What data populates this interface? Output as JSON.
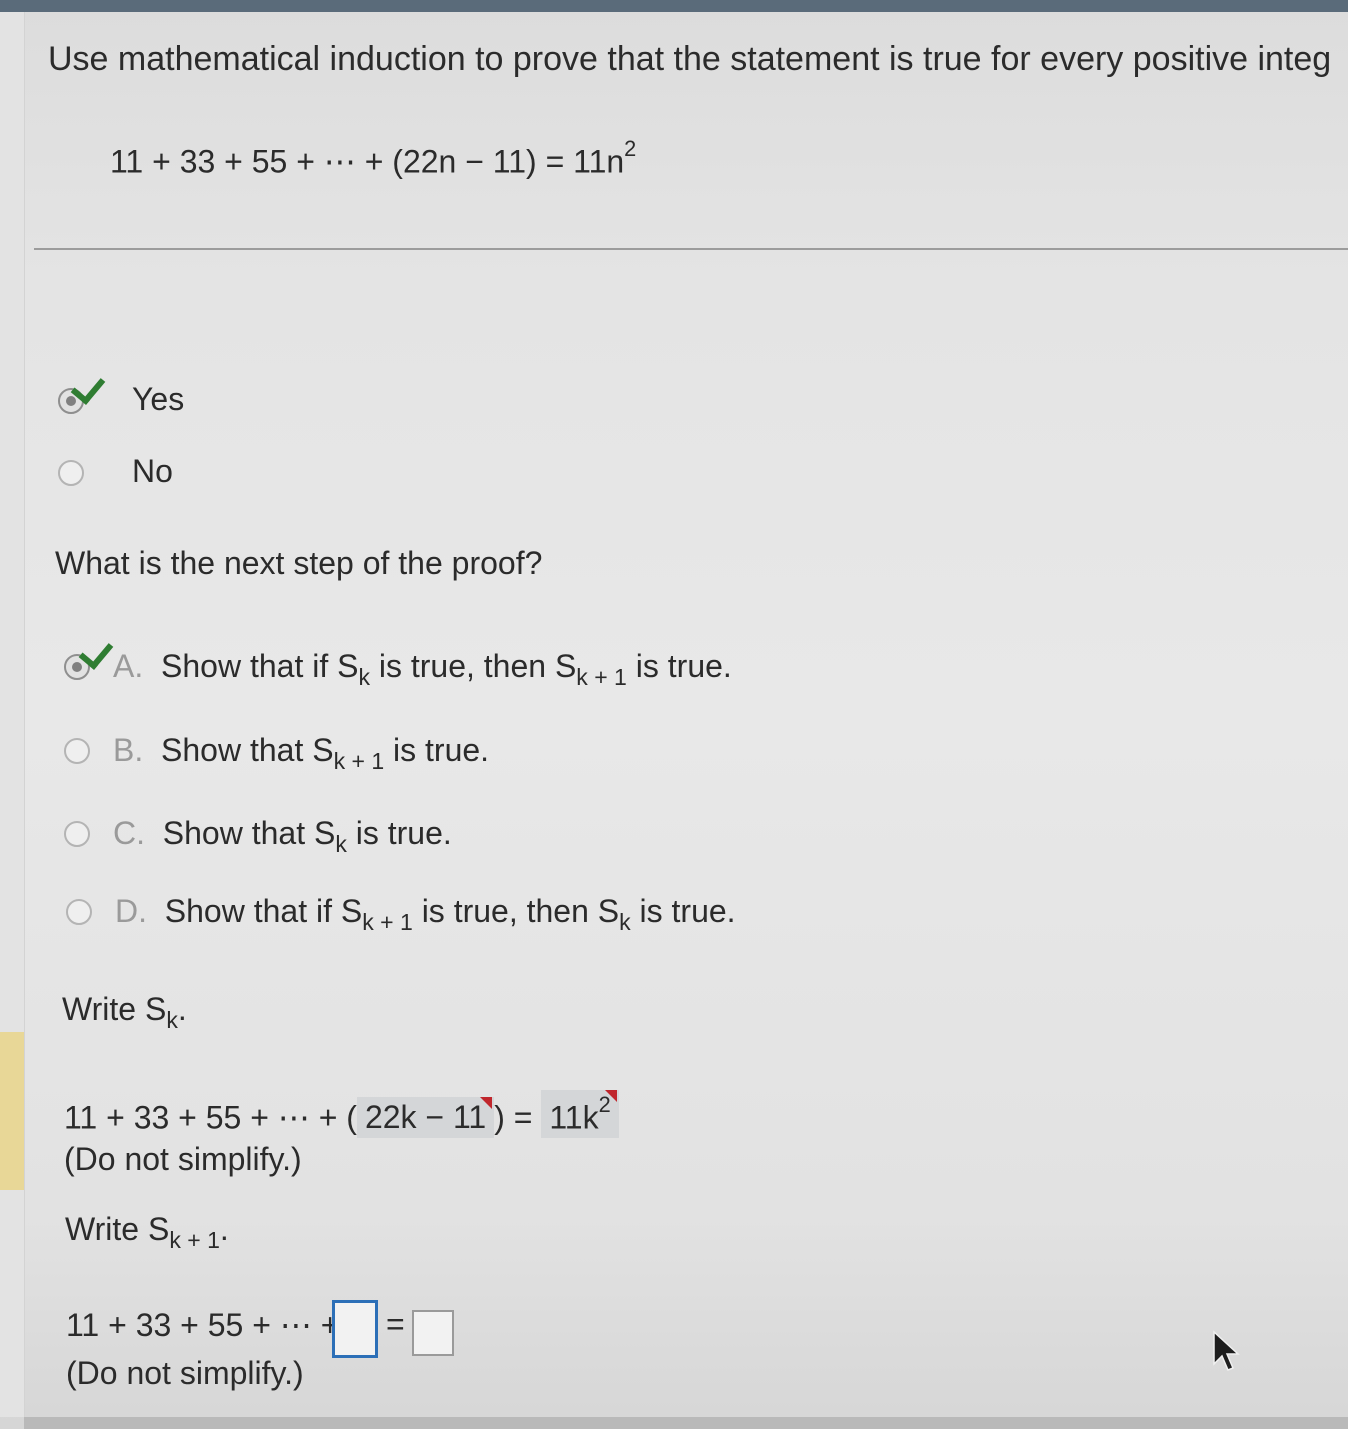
{
  "question": {
    "instruction": "Use mathematical induction to prove that the statement is true for every positive integ",
    "statement": {
      "lhs": "11 + 33 + 55 + ⋯ + (22n − 11) = 11n",
      "exponent": "2"
    }
  },
  "yes_no": {
    "options": [
      {
        "label": "Yes",
        "selected": true,
        "correct": true
      },
      {
        "label": "No",
        "selected": false
      }
    ]
  },
  "next_step": {
    "prompt": "What is the next step of the proof?",
    "options": [
      {
        "letter": "A.",
        "t1": "Show that if S",
        "s1": "k",
        "t2": " is true, then S",
        "s2": "k + 1",
        "t3": " is true.",
        "selected": true,
        "correct": true
      },
      {
        "letter": "B.",
        "t1": "Show that S",
        "s1": "k + 1",
        "t2": " is true.",
        "selected": false
      },
      {
        "letter": "C.",
        "t1": "Show that S",
        "s1": "k",
        "t2": " is true.",
        "selected": false
      },
      {
        "letter": "D.",
        "t1": "Show that if S",
        "s1": "k + 1",
        "t2": " is true, then S",
        "s2": "k",
        "t3": " is true.",
        "selected": false
      }
    ]
  },
  "write_sk": {
    "label": "Write S",
    "sub": "k",
    "end": ".",
    "prefix": "11 + 33 + 55 + ⋯ + (",
    "answer1": "22k − 11",
    "mid": ") =",
    "answer2": "11k",
    "answer2_exp": "2",
    "note": "(Do not simplify.)"
  },
  "write_sk1": {
    "label": "Write S",
    "sub": "k + 1",
    "end": ".",
    "prefix": "11 + 33 + 55 + ⋯ +",
    "equals": "=",
    "note": "(Do not simplify.)"
  },
  "colors": {
    "check": "#2f7d32",
    "input_active_border": "#2c6fb7",
    "flag": "#c0262c",
    "highlight": "#e8d797"
  }
}
